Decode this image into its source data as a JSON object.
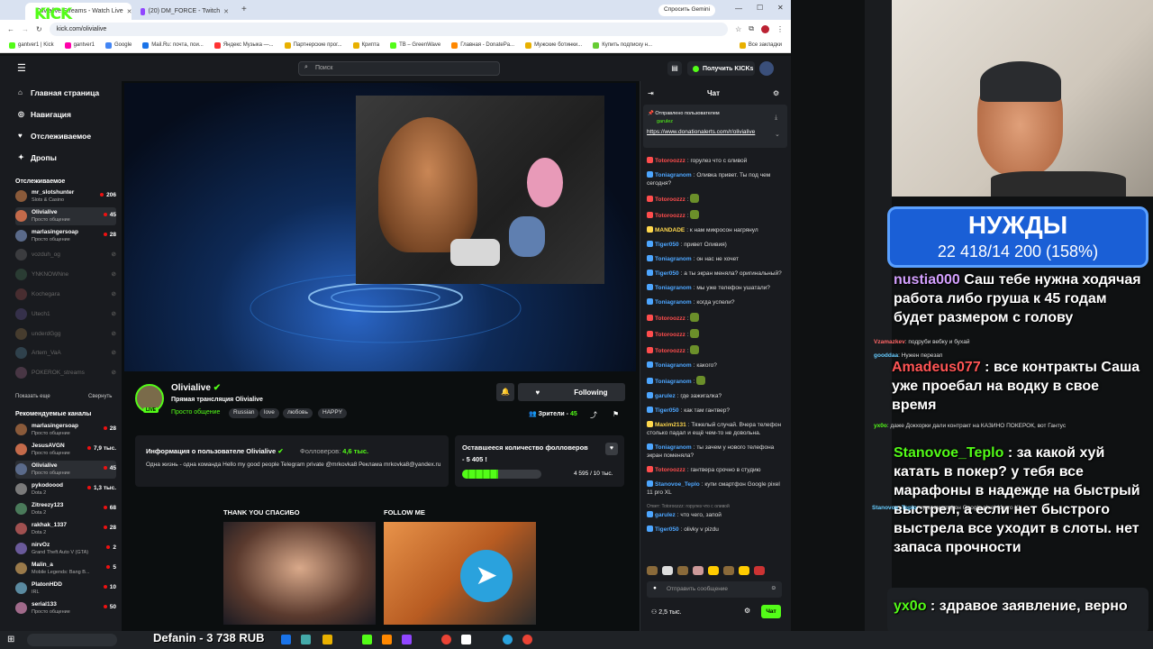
{
  "browser": {
    "tabs": [
      {
        "label": "Olivialive Streams - Watch Live"
      },
      {
        "label": "(20) DM_FORCE - Twitch"
      }
    ],
    "gemini": "Спросить Gemini",
    "url": "kick.com/olivialive",
    "bookmarks": [
      "gantver1 | Kick",
      "gantver1",
      "Google",
      "Mail.Ru: почта, пои...",
      "Яндекс Музыка —...",
      "Партнерские прог...",
      "Криптa",
      "ТВ – GreenWave",
      "Главная - DonatePa...",
      "Мужские ботинки...",
      "Купить подписку н...",
      "Все закладки"
    ]
  },
  "header": {
    "logo": "KICK",
    "search_placeholder": "Поиск",
    "get_kicks": "Получить KICKs"
  },
  "sidebar": {
    "nav": [
      {
        "label": "Главная страница",
        "icon": "home-icon"
      },
      {
        "label": "Навигация",
        "icon": "compass-icon"
      },
      {
        "label": "Отслеживаемое",
        "icon": "heart-icon"
      },
      {
        "label": "Дропы",
        "icon": "gift-icon"
      }
    ],
    "followed_title": "Отслеживаемое",
    "followed": [
      {
        "name": "mr_slotshunter",
        "sub": "Slots & Casino",
        "count": "206",
        "live": true
      },
      {
        "name": "Olivialive",
        "sub": "Просто общение",
        "count": "45",
        "live": true,
        "selected": true
      },
      {
        "name": "marlasingersoap",
        "sub": "Просто общение",
        "count": "28",
        "live": true
      },
      {
        "name": "vozduh_og",
        "live": false
      },
      {
        "name": "YNKNOWNne",
        "live": false
      },
      {
        "name": "Kochegara",
        "live": false
      },
      {
        "name": "Utech1",
        "live": false
      },
      {
        "name": "underdGgg",
        "live": false
      },
      {
        "name": "Artem_VaA",
        "live": false
      },
      {
        "name": "POKEROK_streams",
        "live": false
      }
    ],
    "show_more": "Показать еще",
    "collapse": "Свернуть",
    "recommended_title": "Рекомендуемые каналы",
    "recommended": [
      {
        "name": "marlasingersoap",
        "sub": "Просто общение",
        "count": "28"
      },
      {
        "name": "JesusAVGN",
        "sub": "Просто общение",
        "count": "7,9 тыс."
      },
      {
        "name": "Olivialive",
        "sub": "Просто общение",
        "count": "45",
        "selected": true
      },
      {
        "name": "pykodoood",
        "sub": "Dota 2",
        "count": "1,3 тыс."
      },
      {
        "name": "Zitreezy123",
        "sub": "Dota 2",
        "count": "68"
      },
      {
        "name": "rakhak_1337",
        "sub": "Dota 2",
        "count": "28"
      },
      {
        "name": "nirvOz",
        "sub": "Grand Theft Auto V (GTA)",
        "count": "2"
      },
      {
        "name": "Malin_a",
        "sub": "Mobile Legends: Bang B...",
        "count": "5"
      },
      {
        "name": "PlatonHDD",
        "sub": "IRL",
        "count": "10"
      },
      {
        "name": "serial133",
        "sub": "Просто общение",
        "count": "50"
      }
    ]
  },
  "channel": {
    "name": "Olivialive",
    "live_badge": "LIVE",
    "title": "Прямая трансляция Olivialive",
    "category": "Просто общение",
    "tags": [
      "Russian",
      "love",
      "любовь",
      "HAPPY"
    ],
    "follow_label": "Following",
    "viewers_label": "Зрители",
    "viewers": "45"
  },
  "about": {
    "title": "Информация о пользователе Olivialive",
    "followers_label": "Фолловеров:",
    "followers": "4,6 тыс.",
    "body": "Одна жизнь - одна команда Hello my good people   Telegram private @mrkovka8 Реклама mrkovka8@yandex.ru"
  },
  "goal": {
    "title": "Оставшееся количество фолловеров",
    "remaining": "- 5 405 !",
    "count": "4 595 / 10 тыс.",
    "progress": 0.4595
  },
  "panels": {
    "thank": "THANK YOU СПАСИБО",
    "follow": "FOLLOW ME"
  },
  "chat": {
    "title": "Чат",
    "pinned_head": "Отправлено пользователем",
    "pinned_user": "garulez",
    "pinned_link": "https://www.donationalerts.com/r/olivialive",
    "messages": [
      {
        "user": "Totoroozzz",
        "color": "#ff4d4d",
        "text": "горулез что с оливой"
      },
      {
        "user": "Toniagranom",
        "color": "#4da6ff",
        "text": "Оливка привет. Ты под чем сегодня?"
      },
      {
        "user": "Totoroozzz",
        "color": "#ff4d4d",
        "text": "",
        "emote": true
      },
      {
        "user": "Totoroozzz",
        "color": "#ff4d4d",
        "text": "",
        "emote": true
      },
      {
        "user": "MANDADE",
        "color": "#ffd84d",
        "text": "к нам микросон нагрянул"
      },
      {
        "user": "Tiger050",
        "color": "#4da6ff",
        "text": "привет Оливия)"
      },
      {
        "user": "Toniagranom",
        "color": "#4da6ff",
        "text": "он нас не хочет"
      },
      {
        "user": "Tiger050",
        "color": "#4da6ff",
        "text": "а ты экран меняла? оригинальный?"
      },
      {
        "user": "Toniagranom",
        "color": "#4da6ff",
        "text": "мы уже телефон ушатали?"
      },
      {
        "user": "Toniagranom",
        "color": "#4da6ff",
        "text": "когда успели?"
      },
      {
        "user": "Totoroozzz",
        "color": "#ff4d4d",
        "text": "",
        "emote": true
      },
      {
        "user": "Totoroozzz",
        "color": "#ff4d4d",
        "text": "",
        "emote": true
      },
      {
        "user": "Totoroozzz",
        "color": "#ff4d4d",
        "text": "",
        "emote": true
      },
      {
        "user": "Toniagranom",
        "color": "#4da6ff",
        "text": "какого?"
      },
      {
        "user": "Toniagranom",
        "color": "#4da6ff",
        "text": "",
        "emote": true
      },
      {
        "user": "garulez",
        "color": "#4da6ff",
        "text": "где зажигалка?"
      },
      {
        "user": "Tiger050",
        "color": "#4da6ff",
        "text": "как там гантвер?"
      },
      {
        "user": "Maxim2131",
        "color": "#ffd84d",
        "text": "Тяжелый случай. Вчера телефон столько падал и ещё чем-то не довольна."
      },
      {
        "user": "Toniagranom",
        "color": "#4da6ff",
        "text": "ты зачем у нового телефона экран поменяла?"
      },
      {
        "user": "Totoroozzz",
        "color": "#ff4d4d",
        "text": "гантвера срочно в студию"
      },
      {
        "user": "Stanovoe_Teplo",
        "color": "#4da6ff",
        "text": "купи смартфон Google pixel 11 pro XL"
      },
      {
        "user": "garulez",
        "color": "#4da6ff",
        "text": "что чего, запой",
        "reply": "Ответ: Totoroozzz: горулез что с оливой"
      },
      {
        "user": "Tiger050",
        "color": "#4da6ff",
        "text": "olivky v pizdu"
      }
    ],
    "send_placeholder": "Отправить сообщение",
    "viewer_count": "2,5 тыс.",
    "chat_button": "Чат"
  },
  "overlay": {
    "needs_title": "НУЖДЫ",
    "needs_value": "22 418/14 200 (158%)",
    "big": [
      {
        "user": "nustia000",
        "text": "Саш тебе нужна ходячая работа либо груша к 45 годам будет размером с голову"
      },
      {
        "user": "Amadeus077",
        "text": "все контракты Саша уже проебал на водку в свое время"
      },
      {
        "user": "Stanovoe_Teplo",
        "text": "за какой хуй катать в покер? у тебя все марафоны в надежде на быстрый выстрел, а если нет быстрого выстрела все уходит в слоты. нет запаса прочности"
      },
      {
        "user": "yx0o",
        "text": "здравое заявление, верно"
      }
    ],
    "small": [
      {
        "user": "Vzamazkev",
        "text": "подруби вебку и бухай"
      },
      {
        "user": "gooddaa",
        "text": "Нужен перезап"
      },
      {
        "user": "yx0o",
        "text": "даже Докхорки дали контракт на КАЗИНО ПОКЕРОК, вот Гантус"
      },
      {
        "user": "Stanovoe_Teplo",
        "text": "купи смартфон Google pixel 11 pro XL"
      }
    ],
    "donat": "Defanin - 3 738 RUB"
  }
}
